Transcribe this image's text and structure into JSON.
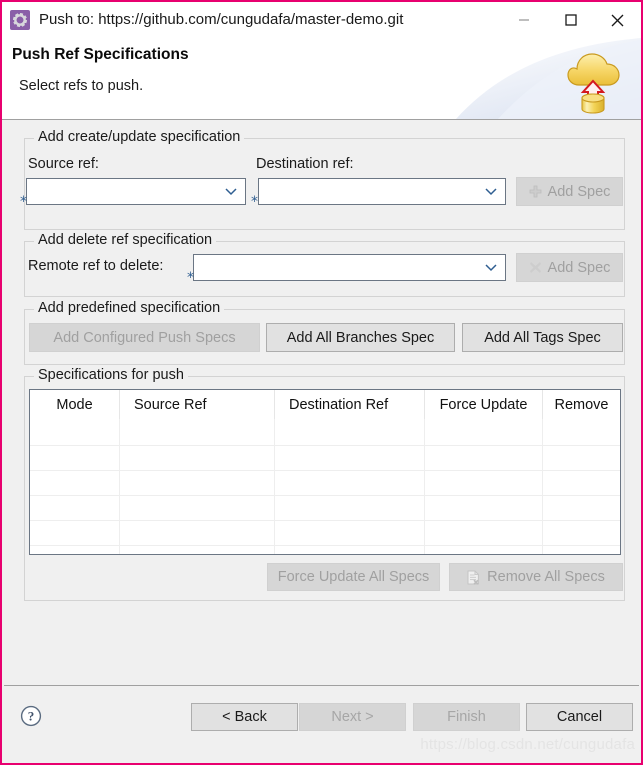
{
  "window": {
    "title": "Push to: https://github.com/cungudafa/master-demo.git",
    "icon": "gear-icon",
    "minimize_label": "minimize-icon",
    "maximize_label": "maximize-icon",
    "close_label": "close-icon"
  },
  "header": {
    "title": "Push Ref Specifications",
    "description": "Select refs to push.",
    "graphic": "cloud-upload-icon"
  },
  "create_update_group": {
    "title": "Add create/update specification",
    "source_label": "Source ref:",
    "source_value": "",
    "destination_label": "Destination ref:",
    "destination_value": "",
    "add_spec_label": "Add Spec",
    "add_spec_icon": "plus-icon",
    "required_marker": "*"
  },
  "delete_group": {
    "title": "Add delete ref specification",
    "remote_label": "Remote ref to delete:",
    "remote_value": "",
    "add_spec_label": "Add Spec",
    "add_spec_icon": "cross-icon",
    "required_marker": "*"
  },
  "predefined_group": {
    "title": "Add predefined specification",
    "buttons": [
      {
        "label": "Add Configured Push Specs",
        "enabled": false
      },
      {
        "label": "Add All Branches Spec",
        "enabled": true
      },
      {
        "label": "Add All Tags Spec",
        "enabled": true
      }
    ]
  },
  "specs_group": {
    "title": "Specifications for push",
    "columns": [
      "Mode",
      "Source Ref",
      "Destination Ref",
      "Force Update",
      "Remove"
    ],
    "rows": [],
    "empty_row_count": 6,
    "force_update_all_label": "Force Update All Specs",
    "remove_all_label": "Remove All Specs",
    "remove_all_icon": "document-remove-icon"
  },
  "buttonbar": {
    "help_icon": "help-icon",
    "back_label": "< Back",
    "next_label": "Next >",
    "finish_label": "Finish",
    "cancel_label": "Cancel"
  },
  "watermark": "https://blog.csdn.net/cungudafa",
  "colors": {
    "dialog_border": "#e8006f",
    "panel_bg": "#f0f0f0",
    "field_border": "#6b7684",
    "required_star": "#2f5e91",
    "accent_icon_gold": "#f2cc52",
    "accent_arrow_red": "#d41920"
  }
}
